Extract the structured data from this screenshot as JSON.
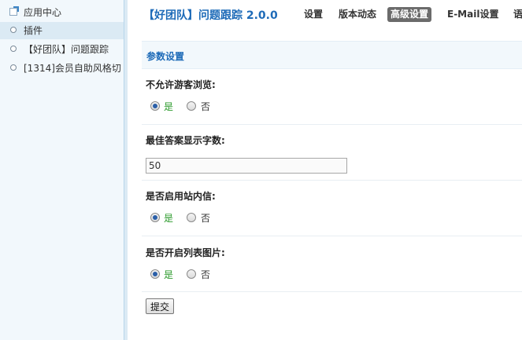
{
  "sidebar": {
    "items": [
      {
        "label": "应用中心",
        "icon": "external-link-icon"
      },
      {
        "label": "插件",
        "icon": "circle-icon",
        "selected": true
      },
      {
        "label": "【好团队】问题跟踪",
        "icon": "circle-icon"
      },
      {
        "label": "[1314]会员自助风格切",
        "icon": "circle-icon"
      }
    ]
  },
  "header": {
    "title": "【好团队】问题跟踪 2.0.0",
    "tabs": [
      {
        "label": "设置"
      },
      {
        "label": "版本动态"
      },
      {
        "label": "高级设置",
        "active": true
      },
      {
        "label": "E-Mail设置"
      },
      {
        "label": "语"
      }
    ]
  },
  "panel": {
    "title": "参数设置",
    "settings": [
      {
        "label": "不允许游客浏览:",
        "yes": "是",
        "no": "否"
      },
      {
        "label": "最佳答案显示字数:",
        "value": "50"
      },
      {
        "label": "是否启用站内信:",
        "yes": "是",
        "no": "否"
      },
      {
        "label": "是否开启列表图片:",
        "yes": "是",
        "no": "否"
      }
    ],
    "submit_label": "提交"
  },
  "colors": {
    "accent": "#1e6bb8",
    "yes_text": "#2b9a2b",
    "active_tab": "#6b6b6b",
    "sidebar_bg": "#f2f8fc"
  }
}
